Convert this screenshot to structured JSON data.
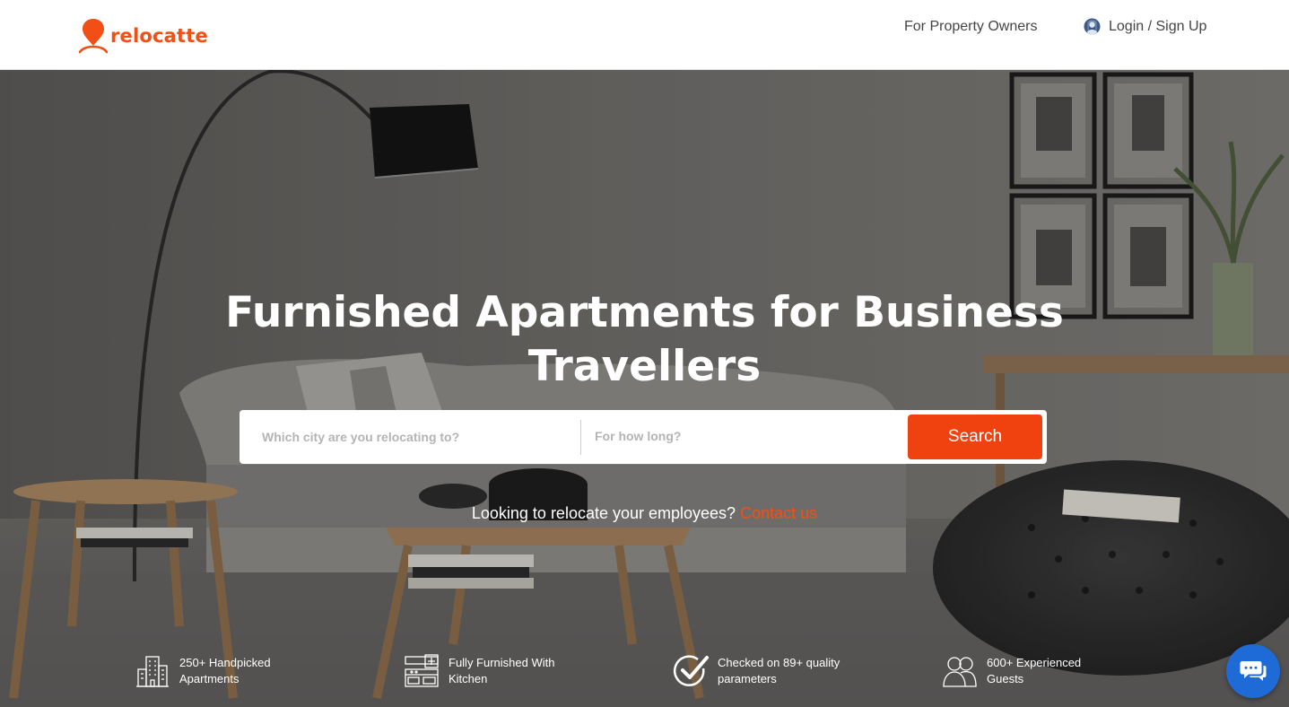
{
  "brand": {
    "name": "relocatte",
    "color": "#f24f17"
  },
  "nav": {
    "owners_label": "For Property Owners",
    "login_label": "Login / Sign Up",
    "login_icon": "user-avatar-icon"
  },
  "hero": {
    "headline_line1": "Furnished Apartments for Business",
    "headline_line2": "Travellers"
  },
  "search": {
    "city_placeholder": "Which city are you relocating to?",
    "duration_placeholder": "For how long?",
    "button_label": "Search",
    "button_color": "#f0420f"
  },
  "contact": {
    "prompt": "Looking to relocate your employees?",
    "link_label": "Contact us"
  },
  "features": [
    {
      "icon": "building-icon",
      "line1": "250+ Handpicked",
      "line2": "Apartments"
    },
    {
      "icon": "kitchen-icon",
      "line1": "Fully Furnished With",
      "line2": "Kitchen"
    },
    {
      "icon": "checkmark-circle-icon",
      "line1": "Checked on 89+ quality",
      "line2": "parameters"
    },
    {
      "icon": "guests-icon",
      "line1": "600+ Experienced",
      "line2": "Guests"
    }
  ],
  "chat": {
    "icon": "chat-bubble-icon",
    "color": "#1e6ad6"
  }
}
